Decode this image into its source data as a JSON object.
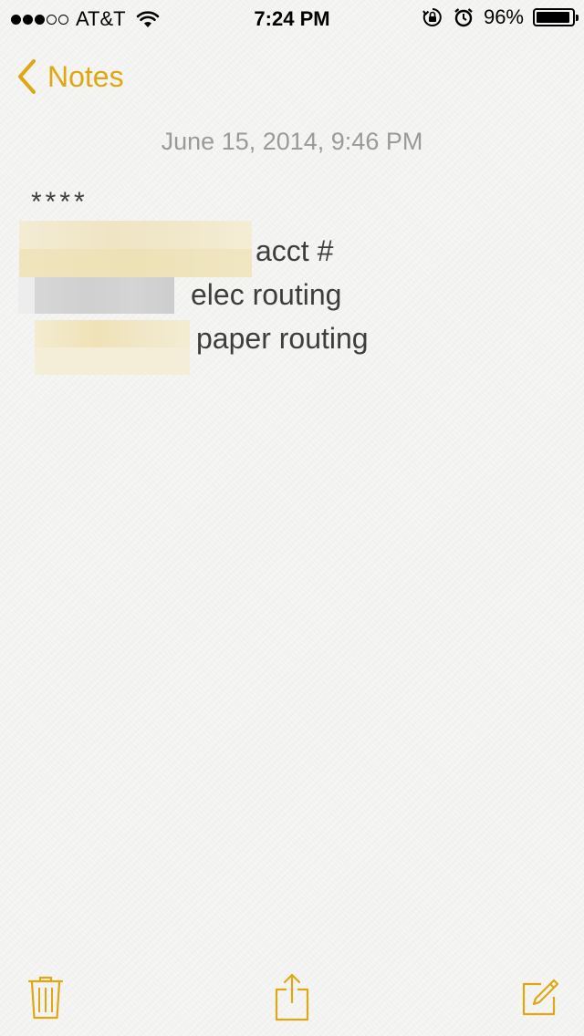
{
  "status_bar": {
    "carrier": "AT&T",
    "time": "7:24 PM",
    "battery_percent": "96%",
    "battery_level": 0.96,
    "signal_bars_full": 3,
    "signal_bars_total": 5
  },
  "nav": {
    "back_label": "Notes"
  },
  "note": {
    "date": "June 15, 2014, 9:46 PM",
    "line1": "****",
    "line2_label": "acct #",
    "line3_label": "elec routing",
    "line4_label": "paper routing"
  },
  "toolbar": {
    "icons": [
      "trash-icon",
      "share-icon",
      "compose-icon"
    ]
  },
  "colors": {
    "accent": "#e0a713",
    "background": "#f6f6f4",
    "text": "#3e3e3e",
    "date_text": "#9a9a9a"
  }
}
